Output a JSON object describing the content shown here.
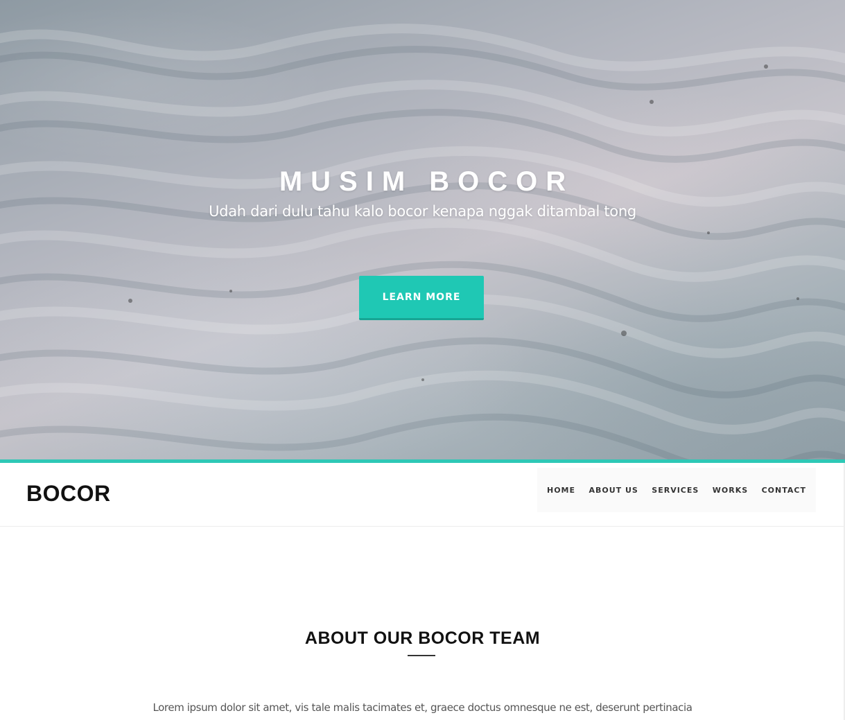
{
  "hero": {
    "title": "MUSIM BOCOR",
    "subtitle": "Udah dari dulu tahu kalo bocor kenapa nggak ditambal tong",
    "button_label": "LEARN MORE",
    "button_color": "#1fc8b4"
  },
  "navbar": {
    "brand": "BOCOR",
    "accent_color": "#2ec8b6",
    "items": [
      {
        "label": "HOME"
      },
      {
        "label": "ABOUT US"
      },
      {
        "label": "SERVICES"
      },
      {
        "label": "WORKS"
      },
      {
        "label": "CONTACT"
      }
    ]
  },
  "about": {
    "title": "ABOUT OUR BOCOR TEAM",
    "text": "Lorem ipsum dolor sit amet, vis tale malis tacimates et, graece doctus omnesque ne est, deserunt pertinacia"
  }
}
